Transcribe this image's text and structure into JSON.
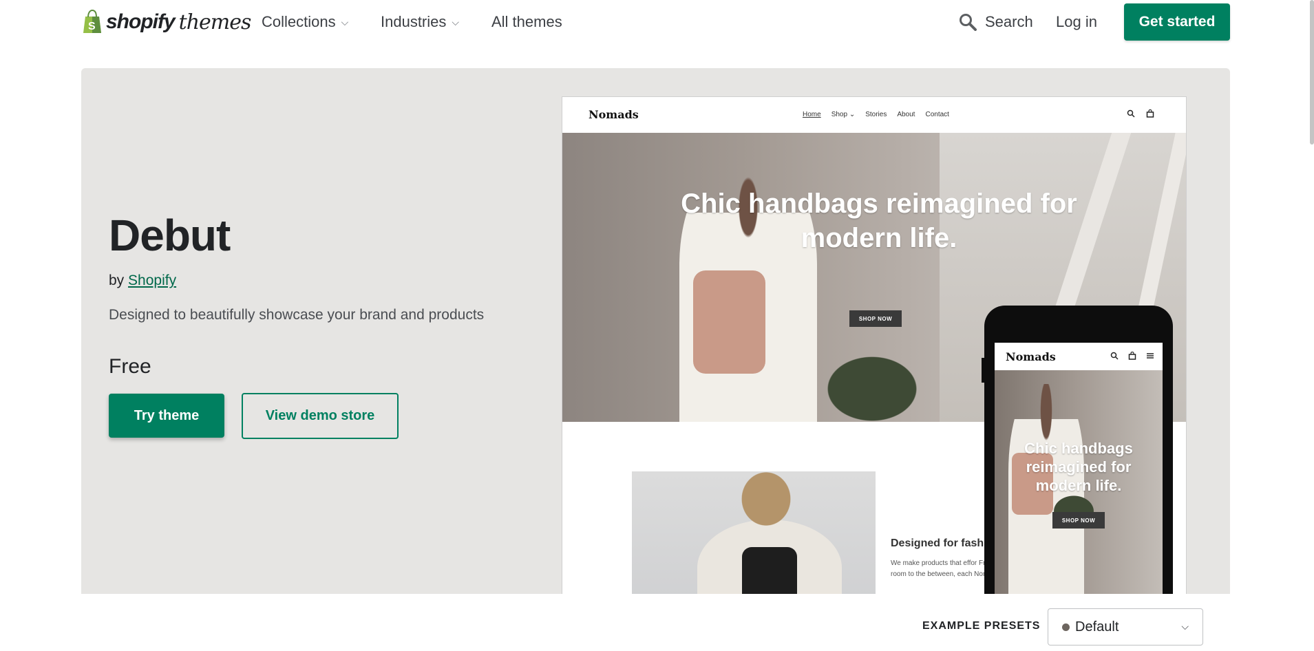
{
  "header": {
    "brand": "shopify",
    "brand_suffix": "themes",
    "nav": [
      {
        "label": "Collections",
        "chevron": true
      },
      {
        "label": "Industries",
        "chevron": true
      },
      {
        "label": "All themes",
        "chevron": false
      }
    ],
    "search_label": "Search",
    "login_label": "Log in",
    "cta_label": "Get started"
  },
  "theme": {
    "name": "Debut",
    "by_prefix": "by",
    "author": "Shopify",
    "description": "Designed to beautifully showcase your brand and products",
    "price": "Free",
    "try_label": "Try theme",
    "demo_label": "View demo store"
  },
  "preview": {
    "store_name": "Nomads",
    "nav": [
      "Home",
      "Shop ⌄",
      "Stories",
      "About",
      "Contact"
    ],
    "hero_title": "Chic handbags reimagined for modern life.",
    "hero_button": "SHOP NOW",
    "section_heading": "Designed for fash",
    "section_text": "We make products that effor From the board room to the between, each Nomads piec",
    "mobile_hero_title": "Chic handbags reimagined for modern life.",
    "mobile_hero_button": "SHOP NOW"
  },
  "presets": {
    "label": "EXAMPLE PRESETS",
    "selected": "Default",
    "dot_color": "#6d655f"
  },
  "colors": {
    "accent": "#008060",
    "hero_bg": "#e6e5e3"
  }
}
